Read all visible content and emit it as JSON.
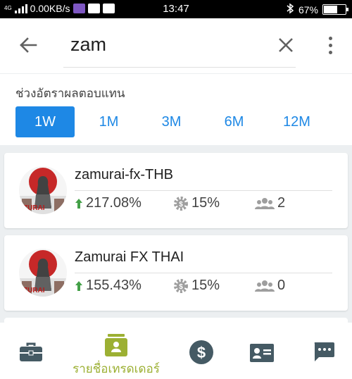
{
  "status_bar": {
    "network_type": "4G",
    "speed": "0.00KB/s",
    "time": "13:47",
    "battery": "67%",
    "battery_level": 0.67
  },
  "search": {
    "query": "zam",
    "back_icon": "arrow-left-icon",
    "clear_icon": "close-icon",
    "more_icon": "more-vert-icon"
  },
  "filter": {
    "label": "ช่วงอัตราผลตอบแทน",
    "periods": [
      "1W",
      "1M",
      "3M",
      "6M",
      "12M"
    ],
    "selected": "1W",
    "accent_color": "#1e88e5"
  },
  "traders": [
    {
      "name": "zamurai-fx-THB",
      "return": "217.08%",
      "fee": "15%",
      "followers": "2"
    },
    {
      "name": "Zamurai FX THAI",
      "return": "155.43%",
      "fee": "15%",
      "followers": "0"
    }
  ],
  "bottom_nav": {
    "items": [
      {
        "icon": "briefcase-icon"
      },
      {
        "icon": "trader-list-icon",
        "label": "รายชื่อเทรดเดอร์"
      },
      {
        "icon": "dollar-circle-icon"
      },
      {
        "icon": "id-card-icon"
      },
      {
        "icon": "chat-icon"
      }
    ],
    "active_color": "#9cb033",
    "inactive_color": "#455a64"
  },
  "colors": {
    "positive": "#43a047",
    "stat_icon": "#9e9e9e"
  }
}
